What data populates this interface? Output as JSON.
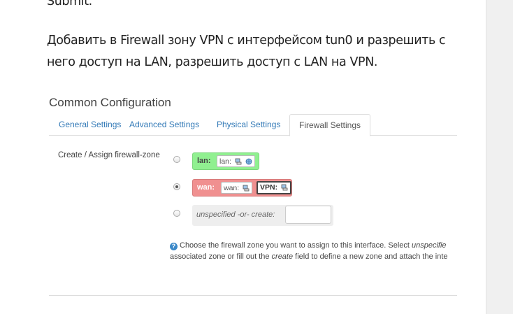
{
  "article": {
    "line_submit": "Submit.",
    "line1": "Добавить в Firewall зону VPN с интерфейсом tun0 и разрешить с",
    "line2": "него доступ на LAN, разрешить доступ с LAN на VPN."
  },
  "config": {
    "title": "Common Configuration",
    "tabs": [
      {
        "label": "General Settings",
        "active": false
      },
      {
        "label": "Advanced Settings",
        "active": false
      },
      {
        "label": "Physical Settings",
        "active": false
      },
      {
        "label": "Firewall Settings",
        "active": true
      }
    ],
    "field_label": "Create / Assign firewall-zone",
    "zones": {
      "lan": {
        "name": "lan:",
        "interfaces": [
          "lan:"
        ],
        "color": "#90f090",
        "selected": false
      },
      "wan": {
        "name": "wan:",
        "interfaces": [
          "wan:",
          "VPN:"
        ],
        "color": "#f09090",
        "selected": true
      },
      "other": {
        "label_prefix": "unspecified -or- create:",
        "input_value": "",
        "selected": false
      }
    },
    "help": {
      "line1_a": "Choose the firewall zone you want to assign to this interface. Select ",
      "line1_em": "unspecifie",
      "line2_a": "associated zone or fill out the ",
      "line2_em": "create",
      "line2_b": " field to define a new zone and attach the inte"
    }
  },
  "icons": {
    "network": "network-icon",
    "globe": "globe-icon",
    "help": "help-icon"
  },
  "colors": {
    "link": "#337ab7",
    "lan_zone": "#90f090",
    "wan_zone": "#f09090"
  }
}
